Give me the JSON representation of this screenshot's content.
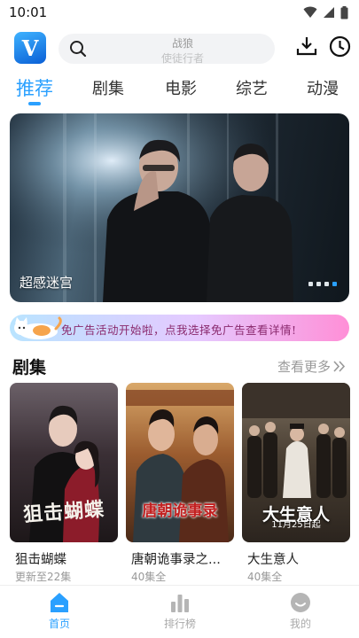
{
  "status_bar": {
    "time": "10:01"
  },
  "header": {
    "logo_letter": "V",
    "search_hint_primary": "战狼",
    "search_hint_secondary": "使徒行者"
  },
  "tabs": [
    {
      "label": "推荐",
      "active": true
    },
    {
      "label": "剧集"
    },
    {
      "label": "电影"
    },
    {
      "label": "综艺"
    },
    {
      "label": "动漫"
    }
  ],
  "banner": {
    "caption": "超感迷宫",
    "slide_count": 4,
    "active_index": 3
  },
  "promo": {
    "text": "免广告活动开始啦，点我选择免广告查看详情!"
  },
  "section": {
    "title": "剧集",
    "more_label": "查看更多"
  },
  "cards": [
    {
      "title": "狙击蝴蝶",
      "subtitle": "更新至22集",
      "poster_art": "狙击蝴蝶"
    },
    {
      "title": "唐朝诡事录之...",
      "subtitle": "40集全",
      "poster_art": "唐朝诡事录"
    },
    {
      "title": "大生意人",
      "subtitle": "40集全",
      "poster_art": "大生意人",
      "poster_sub": "11月25日起"
    }
  ],
  "bottom_nav": [
    {
      "label": "首页",
      "icon": "home-icon",
      "active": true
    },
    {
      "label": "排行榜",
      "icon": "chart-icon"
    },
    {
      "label": "我的",
      "icon": "profile-icon"
    }
  ],
  "colors": {
    "accent": "#2aa0ff"
  }
}
